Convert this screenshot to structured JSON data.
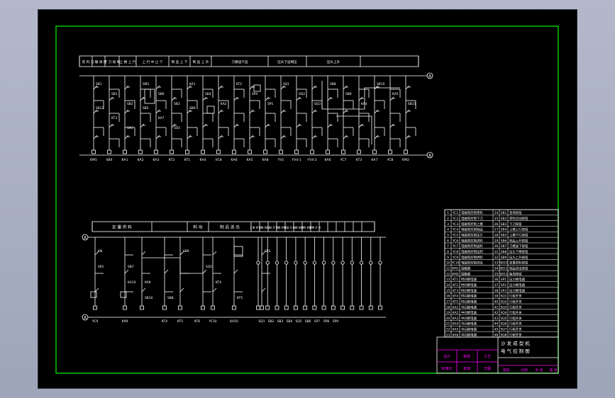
{
  "colors": {
    "background": "#000000",
    "lines": "#ffffff",
    "border": "#00d800",
    "magenta": "#ff00ff",
    "viewport": "#a7adbf"
  },
  "top_header": [
    "卷 料",
    "刀 罐 调 控",
    "下 刀 按 制",
    "上 模 上 行",
    "上 行 中 止 下",
    "制 品 上 下",
    "制 品 上 升",
    "刀模送下运",
    "压头下运制压",
    "压头上升"
  ],
  "top_bus": {
    "left": "A",
    "right": "A"
  },
  "top_bottom_labels": [
    "KM1",
    "SB4",
    "KA1",
    "KA2",
    "KA3",
    "KT2",
    "KT1",
    "KA4",
    "VC8",
    "KA6",
    "KA5",
    "KA8",
    "YV1",
    "YV4-1",
    "YV4-2",
    "KA6",
    "YC7",
    "KT3",
    "KA7",
    "YC8",
    "KM2"
  ],
  "top_contacts": [
    "SB1",
    "SB1",
    "SB2",
    "SM1",
    "SB6",
    "SB3",
    "KA1",
    "SB4",
    "KA2",
    "KT2",
    "SP4",
    "SP5",
    "SQ1",
    "SQ2",
    "SQ3",
    "SB8",
    "SB9",
    "KA4",
    "SB10",
    "KA5",
    "SB11",
    "SB12",
    "KT3",
    "SA1",
    "SB5",
    "KA7",
    "SQ5",
    "SB6"
  ],
  "bottom_header": [
    "定 量 供 料",
    "料 动",
    "制 品 进 出",
    "上 推 自 动",
    "下 推 自 动",
    "压 控 开 关",
    "下 模 开 关",
    "制 品 开 关",
    "上 模 控 制",
    "进 料 控 制",
    "备 用 开 关"
  ],
  "bottom_bus": {
    "left": "A",
    "right": "A"
  },
  "bottom_bottom_labels": [
    "YC9",
    "KA9",
    "KT4",
    "KT5",
    "KT6",
    "YC10",
    "KA10",
    "SQ1",
    "SB2",
    "SB3",
    "SB4",
    "SQ5",
    "SB6",
    "SP7",
    "SP8",
    "SP9"
  ],
  "bottom_contacts": [
    "KN",
    "SB7",
    "KA9",
    "SB8",
    "SB9",
    "SQ5",
    "KT4",
    "KT5",
    "SP3",
    "SP2",
    "KA10",
    "SB10"
  ],
  "legend_rows": [
    {
      "no": "1",
      "code": "YC1",
      "text": "电磁铁控制卷料",
      "no2": "24",
      "code2": "SB1",
      "text2": "急停按钮"
    },
    {
      "no": "2",
      "code": "YC2",
      "text": "电磁铁控制下刀",
      "no2": "25",
      "code2": "SB2",
      "text2": "卷料启动按钮"
    },
    {
      "no": "3",
      "code": "YC3",
      "text": "电磁铁控制上模",
      "no2": "26",
      "code2": "SB3",
      "text2": "下刀按钮"
    },
    {
      "no": "4",
      "code": "YC4",
      "text": "电磁铁控制制品",
      "no2": "27",
      "code2": "SB4",
      "text2": "上模上行按钮"
    },
    {
      "no": "5",
      "code": "YC5",
      "text": "电磁铁控制压头",
      "no2": "28",
      "code2": "SB5",
      "text2": "上模下行按钮"
    },
    {
      "no": "6",
      "code": "YC6",
      "text": "电磁铁控制进料",
      "no2": "29",
      "code2": "SB6",
      "text2": "制品上升按钮"
    },
    {
      "no": "7",
      "code": "YC7",
      "text": "电磁铁控制送料",
      "no2": "30",
      "code2": "SB7",
      "text2": "刀模送下按钮"
    },
    {
      "no": "8",
      "code": "YC8",
      "text": "电磁铁控制压制",
      "no2": "31",
      "code2": "SB8",
      "text2": "压头下降按钮"
    },
    {
      "no": "9",
      "code": "YC9",
      "text": "电磁铁控制供料",
      "no2": "32",
      "code2": "SB9",
      "text2": "压头上升按钮"
    },
    {
      "no": "10",
      "code": "YC10",
      "text": "电磁铁控制进出",
      "no2": "33",
      "code2": "SB10",
      "text2": "定量供料按钮"
    },
    {
      "no": "11",
      "code": "KM1",
      "text": "接触器",
      "no2": "34",
      "code2": "SB11",
      "text2": "制品进出按钮"
    },
    {
      "no": "12",
      "code": "KM2",
      "text": "接触器",
      "no2": "35",
      "code2": "SB12",
      "text2": "备用按钮"
    },
    {
      "no": "13",
      "code": "KT1",
      "text": "时间继电器",
      "no2": "36",
      "code2": "SP1",
      "text2": "压力继电器"
    },
    {
      "no": "14",
      "code": "KT2",
      "text": "时间继电器",
      "no2": "37",
      "code2": "SP2",
      "text2": "压力继电器"
    },
    {
      "no": "15",
      "code": "KT3",
      "text": "时间继电器",
      "no2": "38",
      "code2": "SP3",
      "text2": "压力继电器"
    },
    {
      "no": "16",
      "code": "KT4",
      "text": "时间继电器",
      "no2": "39",
      "code2": "SQ1",
      "text2": "行程开关"
    },
    {
      "no": "17",
      "code": "KT5",
      "text": "时间继电器",
      "no2": "40",
      "code2": "SQ2",
      "text2": "行程开关"
    },
    {
      "no": "18",
      "code": "KA1",
      "text": "中间继电器",
      "no2": "41",
      "code2": "SQ3",
      "text2": "行程开关"
    },
    {
      "no": "19",
      "code": "KA2",
      "text": "中间继电器",
      "no2": "42",
      "code2": "SQ4",
      "text2": "行程开关"
    },
    {
      "no": "20",
      "code": "KA3",
      "text": "中间继电器",
      "no2": "43",
      "code2": "SQ5",
      "text2": "行程开关"
    },
    {
      "no": "21",
      "code": "KA4",
      "text": "中间继电器",
      "no2": "44",
      "code2": "SQ6",
      "text2": "行程开关"
    },
    {
      "no": "22",
      "code": "KA5",
      "text": "中间继电器",
      "no2": "45",
      "code2": "SQ7",
      "text2": "行程开关"
    },
    {
      "no": "23",
      "code": "KA6",
      "text": "中间继电器",
      "no2": "46",
      "code2": "SQ8",
      "text2": "行程开关"
    }
  ],
  "title_block": {
    "title": "沙 发 成 型 机",
    "subtitle": "电 气 控 制 图",
    "left_cells": [
      "设计",
      "审核",
      "工艺",
      "标准化",
      "批准",
      "日期"
    ],
    "right_cells": [
      "图号",
      "比例",
      "共 张",
      "第 张"
    ]
  }
}
